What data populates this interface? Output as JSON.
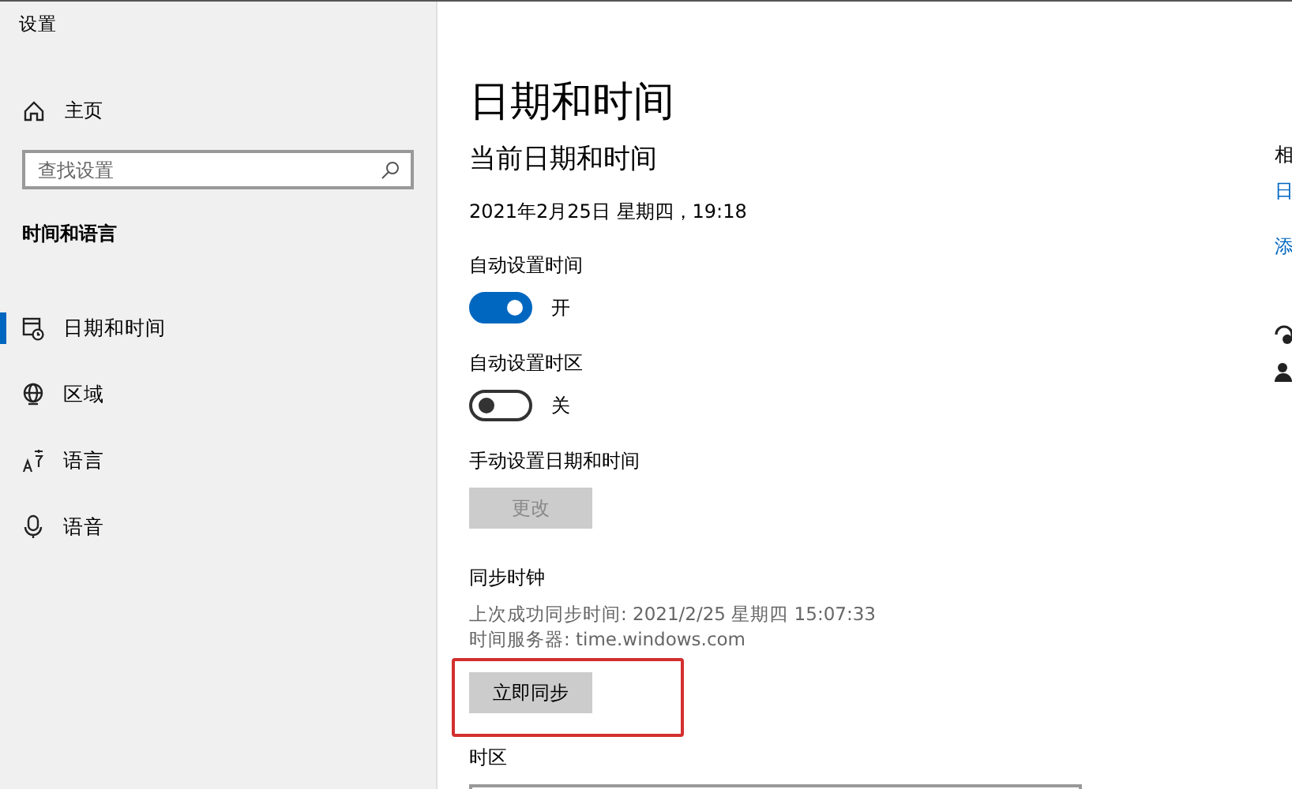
{
  "window": {
    "title": "设置"
  },
  "sidebar": {
    "home": "主页",
    "search": {
      "placeholder": "查找设置"
    },
    "section": "时间和语言",
    "items": [
      {
        "label": "日期和时间",
        "selected": true
      },
      {
        "label": "区域",
        "selected": false
      },
      {
        "label": "语言",
        "selected": false
      },
      {
        "label": "语音",
        "selected": false
      }
    ]
  },
  "main": {
    "title": "日期和时间",
    "subtitle": "当前日期和时间",
    "current": "2021年2月25日 星期四，19:18",
    "settings": [
      {
        "kind": "toggle",
        "label": "自动设置时间",
        "on": true,
        "state_text": "开"
      },
      {
        "kind": "toggle",
        "label": "自动设置时区",
        "on": false,
        "state_text": "关"
      },
      {
        "kind": "button",
        "label": "手动设置日期和时间",
        "button": "更改",
        "disabled": true
      }
    ],
    "sync": {
      "title": "同步时钟",
      "lines": [
        "上次成功同步时间: 2021/2/25 星期四 15:07:33",
        "时间服务器: time.windows.com"
      ],
      "button": "立即同步",
      "highlighted": true
    },
    "timezone": {
      "label": "时区"
    }
  },
  "related": {
    "heading": "相",
    "links": [
      "日",
      "添"
    ]
  }
}
